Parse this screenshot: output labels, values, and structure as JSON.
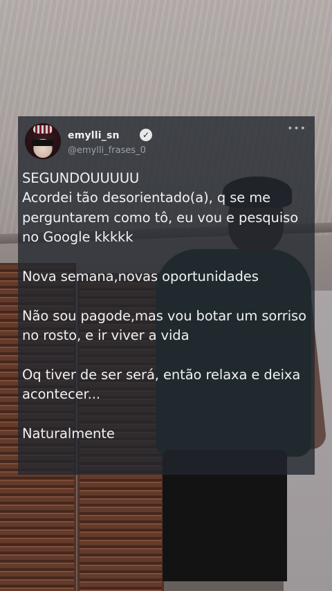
{
  "tweet": {
    "display_name": "emylli_sn",
    "verified_icon": "verified-check-icon",
    "handle": "@emylli_frases_0",
    "more_icon": "more-dots-icon",
    "more_label": "•••",
    "paragraphs": [
      "SEGUNDOUUUUU\nAcordei tão desorientado(a), q se me perguntarem como tô, eu vou e pesquiso no Google kkkkk",
      "Nova semana,novas oportunidades",
      "Não sou pagode,mas vou botar um sorriso no rosto, e ir viver a vida",
      "Oq tiver de ser será, então relaxa e deixa acontecer...",
      "Naturalmente"
    ]
  },
  "colors": {
    "card_background": "#21262e",
    "text": "#f1f1f1",
    "handle_text": "#9aa2ab"
  }
}
